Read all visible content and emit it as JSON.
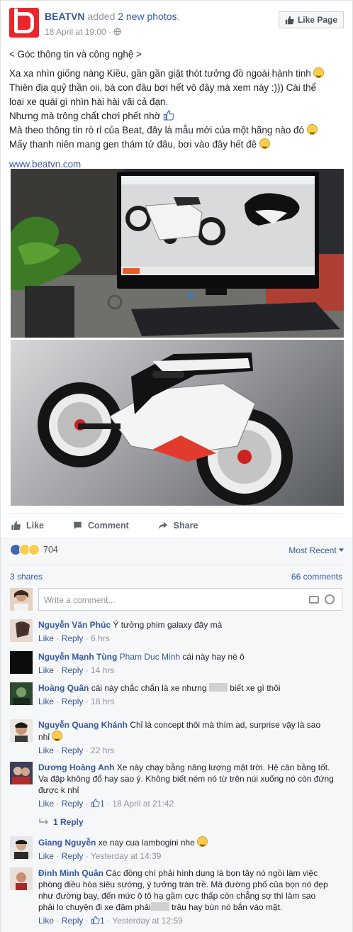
{
  "post": {
    "page_name": "BEATVN",
    "action_text": " added ",
    "photos_link": "2 new photos",
    "action_end": ".",
    "timestamp": "18 April at 19:00",
    "separator": " · ",
    "like_page_label": "Like Page",
    "lines": [
      "< Góc thông tin và công nghệ >",
      "Xa xa nhìn giống nàng Kiều, gần gần giật thót tưởng đồ ngoài hành tinh",
      "Thiên địa quỷ thần oii, bà con đâu bơi hết vô đây mà xem này :))) Cái thể",
      "loại xe quái gì nhìn hài hài vãi cả đạn.",
      "Nhưng mà trông chất chơi phết nhờ",
      "Mà theo thông tin rò rỉ của Beat, đây là mẫu mới của một hãng nào đó",
      "Mấy thanh niên mang gen thám tử đâu, bơi vào đây hết đê"
    ],
    "link": "www.beatvn.com"
  },
  "actions": {
    "like": "Like",
    "comment": "Comment",
    "share": "Share"
  },
  "stats": {
    "reactions_count": "704",
    "most_recent": "Most Recent",
    "shares": "3 shares",
    "comments": "66 comments"
  },
  "composer": {
    "placeholder": "Write a comment..."
  },
  "comments": [
    {
      "author": "Nguyễn Văn Phúc",
      "text_lines": [
        "Ý tưởng phim galaxy đây mà"
      ],
      "like": "Like",
      "reply": "Reply",
      "time": "6 hrs"
    },
    {
      "author": "Nguyễn Mạnh Tùng",
      "tag": "Pham Duc Minh",
      "text_lines": [
        "cái này hay nè ô"
      ],
      "like": "Like",
      "reply": "Reply",
      "time": "14 hrs"
    },
    {
      "author": "Hoàng Quân",
      "text_before": "cái này chắc chắn là xe nhưng",
      "text_after": "biết xe gì thôi",
      "like": "Like",
      "reply": "Reply",
      "time": "18 hrs"
    },
    {
      "author": "Nguyễn Quang Khánh",
      "text_lines": [
        "Chỉ là concept thôi mà thím ad, surprise vậy là sao",
        "nhỉ"
      ],
      "like": "Like",
      "reply": "Reply",
      "time": "22 hrs"
    },
    {
      "author": "Dương Hoàng Anh",
      "text_lines": [
        "Xe này chạy bằng năng lượng mặt trời. Hệ cân bằng tốt.",
        "Va đập không đổ hay sao ý. Không biết ném nó từ trên núi xuống nó còn đứng",
        "được k nhỉ"
      ],
      "like": "Like",
      "reply": "Reply",
      "likes": "1",
      "time": "18 April at 21:42",
      "replies": "1 Reply"
    },
    {
      "author": "Giang Nguyễn",
      "text_lines": [
        "xe nay cua lambogini nhe"
      ],
      "like": "Like",
      "reply": "Reply",
      "time": "Yesterday at 14:39"
    },
    {
      "author": "Đinh Minh Quân",
      "text_lines": [
        "Các đồng chí phải hình dung là bọn tây nó ngồi làm việc",
        "phòng điều hòa siêu sướng, ý tưởng tràn trề. Mà đường phố của bọn nó đẹp",
        "như đường bay, đến mức ô tô hạ gầm cực thấp còn chẳng sợ thì làm sao"
      ],
      "text_before_last": "phải lo chuyện đi xe đâm phải",
      "text_after_last": "trâu hay bùn nó bắn vào mặt.",
      "like": "Like",
      "reply": "Reply",
      "likes": "1",
      "time": "Yesterday at 12:59"
    }
  ]
}
